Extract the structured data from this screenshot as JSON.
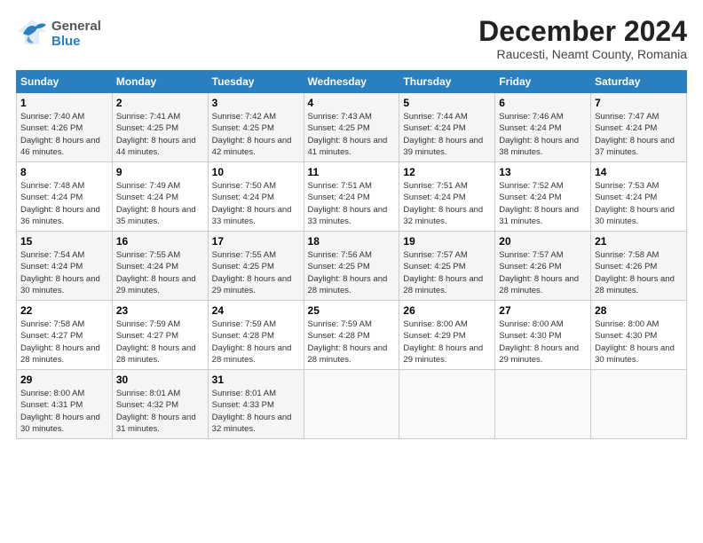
{
  "header": {
    "logo_general": "General",
    "logo_blue": "Blue",
    "title": "December 2024",
    "subtitle": "Raucesti, Neamt County, Romania"
  },
  "calendar": {
    "days_of_week": [
      "Sunday",
      "Monday",
      "Tuesday",
      "Wednesday",
      "Thursday",
      "Friday",
      "Saturday"
    ],
    "weeks": [
      [
        {
          "day": "1",
          "sunrise": "Sunrise: 7:40 AM",
          "sunset": "Sunset: 4:26 PM",
          "daylight": "Daylight: 8 hours and 46 minutes."
        },
        {
          "day": "2",
          "sunrise": "Sunrise: 7:41 AM",
          "sunset": "Sunset: 4:25 PM",
          "daylight": "Daylight: 8 hours and 44 minutes."
        },
        {
          "day": "3",
          "sunrise": "Sunrise: 7:42 AM",
          "sunset": "Sunset: 4:25 PM",
          "daylight": "Daylight: 8 hours and 42 minutes."
        },
        {
          "day": "4",
          "sunrise": "Sunrise: 7:43 AM",
          "sunset": "Sunset: 4:25 PM",
          "daylight": "Daylight: 8 hours and 41 minutes."
        },
        {
          "day": "5",
          "sunrise": "Sunrise: 7:44 AM",
          "sunset": "Sunset: 4:24 PM",
          "daylight": "Daylight: 8 hours and 39 minutes."
        },
        {
          "day": "6",
          "sunrise": "Sunrise: 7:46 AM",
          "sunset": "Sunset: 4:24 PM",
          "daylight": "Daylight: 8 hours and 38 minutes."
        },
        {
          "day": "7",
          "sunrise": "Sunrise: 7:47 AM",
          "sunset": "Sunset: 4:24 PM",
          "daylight": "Daylight: 8 hours and 37 minutes."
        }
      ],
      [
        {
          "day": "8",
          "sunrise": "Sunrise: 7:48 AM",
          "sunset": "Sunset: 4:24 PM",
          "daylight": "Daylight: 8 hours and 36 minutes."
        },
        {
          "day": "9",
          "sunrise": "Sunrise: 7:49 AM",
          "sunset": "Sunset: 4:24 PM",
          "daylight": "Daylight: 8 hours and 35 minutes."
        },
        {
          "day": "10",
          "sunrise": "Sunrise: 7:50 AM",
          "sunset": "Sunset: 4:24 PM",
          "daylight": "Daylight: 8 hours and 33 minutes."
        },
        {
          "day": "11",
          "sunrise": "Sunrise: 7:51 AM",
          "sunset": "Sunset: 4:24 PM",
          "daylight": "Daylight: 8 hours and 33 minutes."
        },
        {
          "day": "12",
          "sunrise": "Sunrise: 7:51 AM",
          "sunset": "Sunset: 4:24 PM",
          "daylight": "Daylight: 8 hours and 32 minutes."
        },
        {
          "day": "13",
          "sunrise": "Sunrise: 7:52 AM",
          "sunset": "Sunset: 4:24 PM",
          "daylight": "Daylight: 8 hours and 31 minutes."
        },
        {
          "day": "14",
          "sunrise": "Sunrise: 7:53 AM",
          "sunset": "Sunset: 4:24 PM",
          "daylight": "Daylight: 8 hours and 30 minutes."
        }
      ],
      [
        {
          "day": "15",
          "sunrise": "Sunrise: 7:54 AM",
          "sunset": "Sunset: 4:24 PM",
          "daylight": "Daylight: 8 hours and 30 minutes."
        },
        {
          "day": "16",
          "sunrise": "Sunrise: 7:55 AM",
          "sunset": "Sunset: 4:24 PM",
          "daylight": "Daylight: 8 hours and 29 minutes."
        },
        {
          "day": "17",
          "sunrise": "Sunrise: 7:55 AM",
          "sunset": "Sunset: 4:25 PM",
          "daylight": "Daylight: 8 hours and 29 minutes."
        },
        {
          "day": "18",
          "sunrise": "Sunrise: 7:56 AM",
          "sunset": "Sunset: 4:25 PM",
          "daylight": "Daylight: 8 hours and 28 minutes."
        },
        {
          "day": "19",
          "sunrise": "Sunrise: 7:57 AM",
          "sunset": "Sunset: 4:25 PM",
          "daylight": "Daylight: 8 hours and 28 minutes."
        },
        {
          "day": "20",
          "sunrise": "Sunrise: 7:57 AM",
          "sunset": "Sunset: 4:26 PM",
          "daylight": "Daylight: 8 hours and 28 minutes."
        },
        {
          "day": "21",
          "sunrise": "Sunrise: 7:58 AM",
          "sunset": "Sunset: 4:26 PM",
          "daylight": "Daylight: 8 hours and 28 minutes."
        }
      ],
      [
        {
          "day": "22",
          "sunrise": "Sunrise: 7:58 AM",
          "sunset": "Sunset: 4:27 PM",
          "daylight": "Daylight: 8 hours and 28 minutes."
        },
        {
          "day": "23",
          "sunrise": "Sunrise: 7:59 AM",
          "sunset": "Sunset: 4:27 PM",
          "daylight": "Daylight: 8 hours and 28 minutes."
        },
        {
          "day": "24",
          "sunrise": "Sunrise: 7:59 AM",
          "sunset": "Sunset: 4:28 PM",
          "daylight": "Daylight: 8 hours and 28 minutes."
        },
        {
          "day": "25",
          "sunrise": "Sunrise: 7:59 AM",
          "sunset": "Sunset: 4:28 PM",
          "daylight": "Daylight: 8 hours and 28 minutes."
        },
        {
          "day": "26",
          "sunrise": "Sunrise: 8:00 AM",
          "sunset": "Sunset: 4:29 PM",
          "daylight": "Daylight: 8 hours and 29 minutes."
        },
        {
          "day": "27",
          "sunrise": "Sunrise: 8:00 AM",
          "sunset": "Sunset: 4:30 PM",
          "daylight": "Daylight: 8 hours and 29 minutes."
        },
        {
          "day": "28",
          "sunrise": "Sunrise: 8:00 AM",
          "sunset": "Sunset: 4:30 PM",
          "daylight": "Daylight: 8 hours and 30 minutes."
        }
      ],
      [
        {
          "day": "29",
          "sunrise": "Sunrise: 8:00 AM",
          "sunset": "Sunset: 4:31 PM",
          "daylight": "Daylight: 8 hours and 30 minutes."
        },
        {
          "day": "30",
          "sunrise": "Sunrise: 8:01 AM",
          "sunset": "Sunset: 4:32 PM",
          "daylight": "Daylight: 8 hours and 31 minutes."
        },
        {
          "day": "31",
          "sunrise": "Sunrise: 8:01 AM",
          "sunset": "Sunset: 4:33 PM",
          "daylight": "Daylight: 8 hours and 32 minutes."
        },
        null,
        null,
        null,
        null
      ]
    ]
  }
}
